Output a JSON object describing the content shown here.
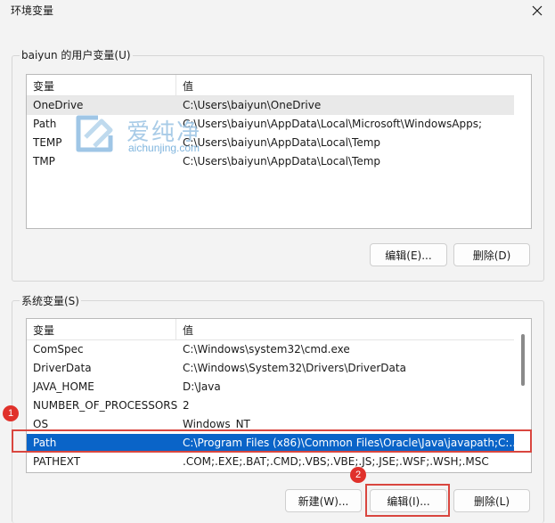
{
  "window": {
    "title": "环境变量",
    "close_icon": "close-icon"
  },
  "user_vars": {
    "group_label": "baiyun 的用户变量(U)",
    "col_variable": "变量",
    "col_value": "值",
    "rows": [
      {
        "name": "OneDrive",
        "value": "C:\\Users\\baiyun\\OneDrive"
      },
      {
        "name": "Path",
        "value": "C:\\Users\\baiyun\\AppData\\Local\\Microsoft\\WindowsApps;"
      },
      {
        "name": "TEMP",
        "value": "C:\\Users\\baiyun\\AppData\\Local\\Temp"
      },
      {
        "name": "TMP",
        "value": "C:\\Users\\baiyun\\AppData\\Local\\Temp"
      }
    ],
    "edit_label": "编辑(E)...",
    "delete_label": "删除(D)"
  },
  "system_vars": {
    "group_label": "系统变量(S)",
    "col_variable": "变量",
    "col_value": "值",
    "rows": [
      {
        "name": "ComSpec",
        "value": "C:\\Windows\\system32\\cmd.exe"
      },
      {
        "name": "DriverData",
        "value": "C:\\Windows\\System32\\Drivers\\DriverData"
      },
      {
        "name": "JAVA_HOME",
        "value": "D:\\Java"
      },
      {
        "name": "NUMBER_OF_PROCESSORS",
        "value": "2"
      },
      {
        "name": "OS",
        "value": "Windows_NT"
      },
      {
        "name": "Path",
        "value": "C:\\Program Files (x86)\\Common Files\\Oracle\\Java\\javapath;C:..."
      },
      {
        "name": "PATHEXT",
        "value": ".COM;.EXE;.BAT;.CMD;.VBS;.VBE;.JS;.JSE;.WSF;.WSH;.MSC"
      }
    ],
    "selected_row": "Path",
    "new_label": "新建(W)...",
    "edit_label": "编辑(I)...",
    "delete_label": "删除(L)"
  },
  "annotations": {
    "step1": "1",
    "step2": "2",
    "color": "#d9463f"
  },
  "watermark": {
    "text": "爱纯净",
    "url": "aichunjing.com"
  },
  "colors": {
    "selection": "#0a64c8",
    "background": "#f3f3f3"
  }
}
